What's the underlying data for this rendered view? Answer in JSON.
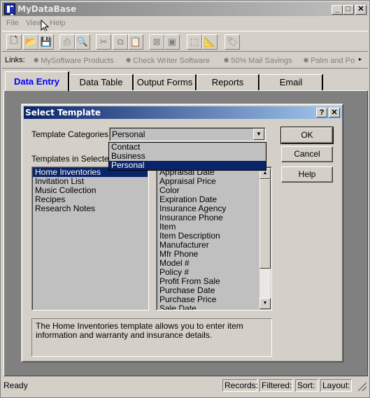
{
  "window": {
    "title": "MyDataBase",
    "controls": {
      "minimize": "_",
      "maximize": "□",
      "close": "✕"
    }
  },
  "menu": [
    {
      "label": "File"
    },
    {
      "label": "View"
    },
    {
      "label": "Help"
    }
  ],
  "toolbar": [
    {
      "icon": "new-document-icon",
      "glyph": "🗋",
      "enabled": true
    },
    {
      "icon": "open-folder-icon",
      "glyph": "📂",
      "enabled": true
    },
    {
      "icon": "save-icon",
      "glyph": "💾",
      "enabled": false
    },
    {
      "icon": "print-icon",
      "glyph": "⎙",
      "enabled": false
    },
    {
      "icon": "print-preview-icon",
      "glyph": "🔍",
      "enabled": false
    },
    {
      "icon": "cut-icon",
      "glyph": "✂",
      "enabled": false
    },
    {
      "icon": "copy-icon",
      "glyph": "⧉",
      "enabled": false
    },
    {
      "icon": "paste-icon",
      "glyph": "📋",
      "enabled": false
    },
    {
      "icon": "delete-record-icon",
      "glyph": "⊠",
      "enabled": false
    },
    {
      "icon": "new-record-icon",
      "glyph": "▣",
      "enabled": false
    },
    {
      "icon": "form-layout-icon",
      "glyph": "⬚",
      "enabled": false
    },
    {
      "icon": "ruler-icon",
      "glyph": "📐",
      "enabled": false
    },
    {
      "icon": "label-tag-icon",
      "glyph": "🏷",
      "enabled": false
    }
  ],
  "links": {
    "label": "Links:",
    "items": [
      {
        "label": "MySoftware Products"
      },
      {
        "label": "Check Writer Software"
      },
      {
        "label": "50% Mail Savings"
      },
      {
        "label": "Palm and Po"
      }
    ],
    "more": "▸"
  },
  "tabs": [
    {
      "label": "Data Entry",
      "active": true
    },
    {
      "label": "Data Table",
      "active": false
    },
    {
      "label": "Output Forms",
      "active": false
    },
    {
      "label": "Reports",
      "active": false
    },
    {
      "label": "Email",
      "active": false
    }
  ],
  "dialog": {
    "title": "Select Template",
    "help_btn": "?",
    "close_btn": "✕",
    "categories_label": "Template Categories:",
    "categories_value": "Personal",
    "category_options": [
      {
        "label": "Contact",
        "selected": false
      },
      {
        "label": "Business",
        "selected": false
      },
      {
        "label": "Personal",
        "selected": true
      }
    ],
    "templates_label": "Templates in Selected C",
    "templates": [
      {
        "label": "Home Inventories",
        "selected": true
      },
      {
        "label": "Invitation List",
        "selected": false
      },
      {
        "label": "Music Collection",
        "selected": false
      },
      {
        "label": "Recipes",
        "selected": false
      },
      {
        "label": "Research Notes",
        "selected": false
      }
    ],
    "fields": [
      "Appraisal Date",
      "Appraisal Price",
      "Color",
      "Expiration Date",
      "Insurance Agency",
      "Insurance Phone",
      "Item",
      "Item Description",
      "Manufacturer",
      "Mfr Phone",
      "Model #",
      "Policy #",
      "Profit From Sale",
      "Purchase Date",
      "Purchase Price",
      "Sale Date"
    ],
    "buttons": {
      "ok": "OK",
      "cancel": "Cancel",
      "help": "Help"
    },
    "description": "The Home Inventories template allows you to enter item information and warranty and insurance details."
  },
  "status": {
    "ready": "Ready",
    "records": "Records:",
    "filtered": "Filtered:",
    "sort": "Sort:",
    "layout": "Layout:"
  }
}
